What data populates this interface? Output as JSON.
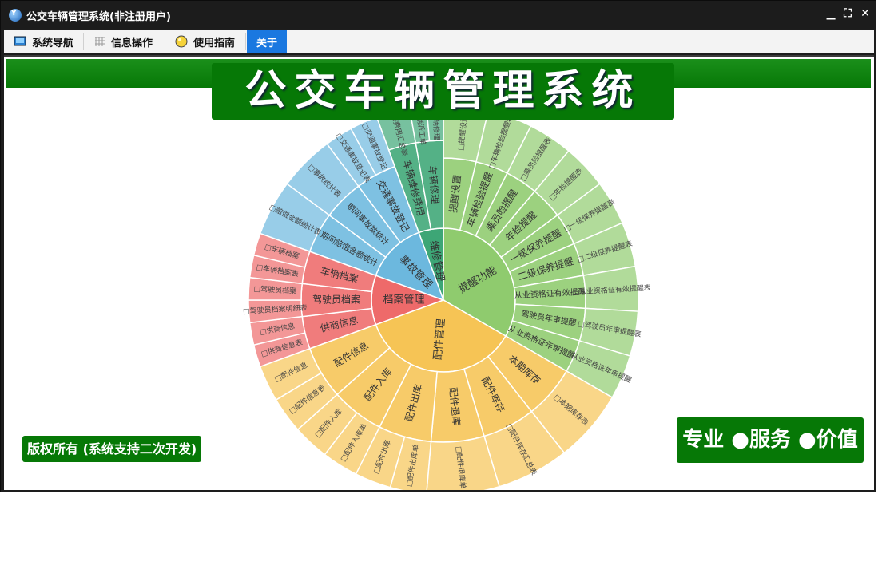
{
  "window": {
    "title": "公交车辆管理系统(非注册用户)",
    "app_icon_letter": "Y"
  },
  "toolbar": {
    "tabs": [
      {
        "label": "系统导航",
        "icon": "monitor-icon"
      },
      {
        "label": "信息操作",
        "icon": "grid-icon"
      },
      {
        "label": "使用指南",
        "icon": "lightbulb-icon"
      },
      {
        "label": "关于",
        "icon": ""
      }
    ],
    "active_tab": "关于"
  },
  "banner": {
    "title": "公交车辆管理系统"
  },
  "footer": {
    "copyright": "版权所有 (系统支持二次开发)",
    "motto": "专业 ●服务 ●价值"
  },
  "colors": {
    "brand_green": "#067806",
    "active_tab": "#1a78e0",
    "reminder": "#8fcb6e",
    "maintenance": "#3da676",
    "accident": "#6cb8de",
    "archive": "#ee6a6a",
    "parts": "#f6c455"
  },
  "sunburst": {
    "groups": [
      {
        "label": "提醒功能",
        "color": "#8fcb6e",
        "children": [
          {
            "label": "提醒设置",
            "leaves": [
              "□提醒设置"
            ]
          },
          {
            "label": "车辆检验提醒",
            "leaves": [
              "□车辆检验提醒表"
            ]
          },
          {
            "label": "乘员险提醒",
            "leaves": [
              "□乘员险提醒表"
            ]
          },
          {
            "label": "年检提醒",
            "leaves": [
              "□年检提醒表"
            ]
          },
          {
            "label": "一级保养提醒",
            "leaves": [
              "□一级保养提醒表"
            ]
          },
          {
            "label": "二级保养提醒",
            "leaves": [
              "□二级保养提醒表"
            ]
          },
          {
            "label": "从业资格证有效提醒",
            "leaves": [
              "□从业资格证有效提醒表"
            ]
          },
          {
            "label": "驾驶员年审提醒",
            "leaves": [
              "□驾驶员年审提醒表"
            ]
          },
          {
            "label": "从业资格证年审提醒",
            "leaves": [
              "□从业资格证年审提醒"
            ]
          }
        ]
      },
      {
        "label": "维修管理",
        "color": "#3da676",
        "children": [
          {
            "label": "车辆维修费用",
            "leaves": [
              "□维修费用汇总表"
            ]
          },
          {
            "label": "车辆修理",
            "leaves": [
              "□车辆派工单",
              "□车辆修理"
            ]
          }
        ]
      },
      {
        "label": "事故管理",
        "color": "#6cb8de",
        "children": [
          {
            "label": "期间赔偿金额统计",
            "leaves": [
              "□赔偿金额统计表"
            ]
          },
          {
            "label": "期间事故数统计",
            "leaves": [
              "□事故统计表"
            ]
          },
          {
            "label": "交通事故登记",
            "leaves": [
              "□交通事故登记表",
              "□交通事故登记"
            ]
          }
        ]
      },
      {
        "label": "档案管理",
        "color": "#ee6a6a",
        "children": [
          {
            "label": "供商信息",
            "leaves": [
              "□供商信息表",
              "□供商信息"
            ]
          },
          {
            "label": "驾驶员档案",
            "leaves": [
              "□驾驶员档案明细表",
              "□驾驶员档案"
            ]
          },
          {
            "label": "车辆档案",
            "leaves": [
              "□车辆档案表",
              "□车辆档案"
            ]
          }
        ]
      },
      {
        "label": "配件管理",
        "color": "#f6c455",
        "children": [
          {
            "label": "本期库存",
            "leaves": [
              "□本期库存表"
            ]
          },
          {
            "label": "配件库存",
            "leaves": [
              "□配件库存汇总表"
            ]
          },
          {
            "label": "配件退库",
            "leaves": [
              "□配件退库单"
            ]
          },
          {
            "label": "配件出库",
            "leaves": [
              "□配件出库单",
              "□配件出库"
            ]
          },
          {
            "label": "配件入库",
            "leaves": [
              "□配件入库单",
              "□配件入库"
            ]
          },
          {
            "label": "配件信息",
            "leaves": [
              "□配件信息表",
              "□配件信息"
            ]
          }
        ]
      }
    ]
  }
}
